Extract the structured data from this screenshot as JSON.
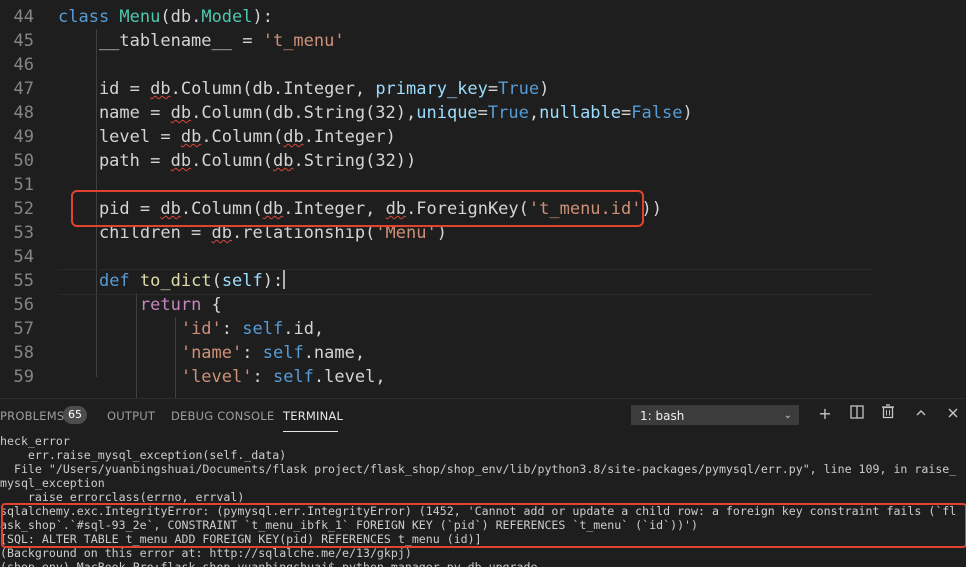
{
  "editor": {
    "lines": [
      {
        "num": "44",
        "segments": [
          {
            "t": "class ",
            "c": "kw"
          },
          {
            "t": "Menu",
            "c": "cls"
          },
          {
            "t": "(db.",
            "c": ""
          },
          {
            "t": "Model",
            "c": "cls"
          },
          {
            "t": "):",
            "c": ""
          }
        ]
      },
      {
        "num": "45",
        "segments": [
          {
            "t": "    __tablename__ = ",
            "c": ""
          },
          {
            "t": "'t_menu'",
            "c": "str"
          }
        ]
      },
      {
        "num": "46",
        "segments": []
      },
      {
        "num": "47",
        "segments": [
          {
            "t": "    id = ",
            "c": ""
          },
          {
            "t": "db",
            "c": "sq"
          },
          {
            "t": ".Column(db.Integer, ",
            "c": ""
          },
          {
            "t": "primary_key",
            "c": "prm"
          },
          {
            "t": "=",
            "c": ""
          },
          {
            "t": "True",
            "c": "kw"
          },
          {
            "t": ")",
            "c": ""
          }
        ]
      },
      {
        "num": "48",
        "segments": [
          {
            "t": "    name = ",
            "c": ""
          },
          {
            "t": "db",
            "c": "sq"
          },
          {
            "t": ".Column(db.String(32),",
            "c": ""
          },
          {
            "t": "unique",
            "c": "prm"
          },
          {
            "t": "=",
            "c": ""
          },
          {
            "t": "True",
            "c": "kw"
          },
          {
            "t": ",",
            "c": ""
          },
          {
            "t": "nullable",
            "c": "prm"
          },
          {
            "t": "=",
            "c": ""
          },
          {
            "t": "False",
            "c": "kw"
          },
          {
            "t": ")",
            "c": ""
          }
        ]
      },
      {
        "num": "49",
        "segments": [
          {
            "t": "    level = ",
            "c": ""
          },
          {
            "t": "db",
            "c": "sq"
          },
          {
            "t": ".Column(",
            "c": ""
          },
          {
            "t": "db",
            "c": "sq"
          },
          {
            "t": ".Integer)",
            "c": ""
          }
        ]
      },
      {
        "num": "50",
        "segments": [
          {
            "t": "    path = ",
            "c": ""
          },
          {
            "t": "db",
            "c": "sq"
          },
          {
            "t": ".Column(",
            "c": ""
          },
          {
            "t": "db",
            "c": "sq"
          },
          {
            "t": ".String(32))",
            "c": ""
          }
        ]
      },
      {
        "num": "51",
        "segments": []
      },
      {
        "num": "52",
        "segments": [
          {
            "t": "    pid = ",
            "c": ""
          },
          {
            "t": "db",
            "c": "sq"
          },
          {
            "t": ".Column(",
            "c": ""
          },
          {
            "t": "db",
            "c": "sq"
          },
          {
            "t": ".Integer, ",
            "c": ""
          },
          {
            "t": "db",
            "c": "sq"
          },
          {
            "t": ".ForeignKey(",
            "c": ""
          },
          {
            "t": "'t_menu.id'",
            "c": "str"
          },
          {
            "t": "))",
            "c": ""
          }
        ]
      },
      {
        "num": "53",
        "segments": [
          {
            "t": "    children = ",
            "c": ""
          },
          {
            "t": "db",
            "c": "sq"
          },
          {
            "t": ".relationship(",
            "c": ""
          },
          {
            "t": "'Menu'",
            "c": "str"
          },
          {
            "t": ")",
            "c": ""
          }
        ]
      },
      {
        "num": "54",
        "segments": []
      },
      {
        "num": "55",
        "segments": [
          {
            "t": "    ",
            "c": ""
          },
          {
            "t": "def ",
            "c": "kw"
          },
          {
            "t": "to_dict",
            "c": "fn"
          },
          {
            "t": "(",
            "c": ""
          },
          {
            "t": "self",
            "c": "prm"
          },
          {
            "t": "):",
            "c": ""
          },
          {
            "t": "",
            "c": "cursor"
          }
        ]
      },
      {
        "num": "56",
        "segments": [
          {
            "t": "        ",
            "c": ""
          },
          {
            "t": "return ",
            "c": "ctl"
          },
          {
            "t": "{",
            "c": ""
          }
        ]
      },
      {
        "num": "57",
        "segments": [
          {
            "t": "            ",
            "c": ""
          },
          {
            "t": "'id'",
            "c": "str"
          },
          {
            "t": ": ",
            "c": ""
          },
          {
            "t": "self",
            "c": "kw"
          },
          {
            "t": ".id,",
            "c": ""
          }
        ]
      },
      {
        "num": "58",
        "segments": [
          {
            "t": "            ",
            "c": ""
          },
          {
            "t": "'name'",
            "c": "str"
          },
          {
            "t": ": ",
            "c": ""
          },
          {
            "t": "self",
            "c": "kw"
          },
          {
            "t": ".name,",
            "c": ""
          }
        ]
      },
      {
        "num": "59",
        "segments": [
          {
            "t": "            ",
            "c": ""
          },
          {
            "t": "'level'",
            "c": "str"
          },
          {
            "t": ": ",
            "c": ""
          },
          {
            "t": "self",
            "c": "kw"
          },
          {
            "t": ".level,",
            "c": ""
          }
        ]
      }
    ]
  },
  "panel": {
    "tabs": [
      {
        "label": "PROBLEMS",
        "name": "tab-problems"
      },
      {
        "label": "OUTPUT",
        "name": "tab-output"
      },
      {
        "label": "DEBUG CONSOLE",
        "name": "tab-debug-console"
      },
      {
        "label": "TERMINAL",
        "name": "tab-terminal"
      }
    ],
    "problems_count": "65",
    "terminal_select": "1: bash",
    "icons": [
      "add-icon",
      "split-icon",
      "trash-icon",
      "chevron-up-icon",
      "close-icon"
    ]
  },
  "terminal": {
    "lines": [
      "heck_error",
      "    err.raise_mysql_exception(self._data)",
      "  File \"/Users/yuanbingshuai/Documents/flask project/flask_shop/shop_env/lib/python3.8/site-packages/pymysql/err.py\", line 109, in raise_",
      "mysql_exception",
      "    raise errorclass(errno, errval)",
      "sqlalchemy.exc.IntegrityError: (pymysql.err.IntegrityError) (1452, 'Cannot add or update a child row: a foreign key constraint fails (`fl",
      "ask_shop`.`#sql-93_2e`, CONSTRAINT `t_menu_ibfk_1` FOREIGN KEY (`pid`) REFERENCES `t_menu` (`id`))')",
      "[SQL: ALTER TABLE t_menu ADD FOREIGN KEY(pid) REFERENCES t_menu (id)]",
      "(Background on this error at: http://sqlalche.me/e/13/gkpj)",
      "(shop_env) MacBook-Pro:flask_shop yuanbingshuai$ python manager.py db upgrade"
    ]
  },
  "colors": {
    "highlight_border": "#e0432e",
    "editor_bg": "#1e1e1e"
  }
}
